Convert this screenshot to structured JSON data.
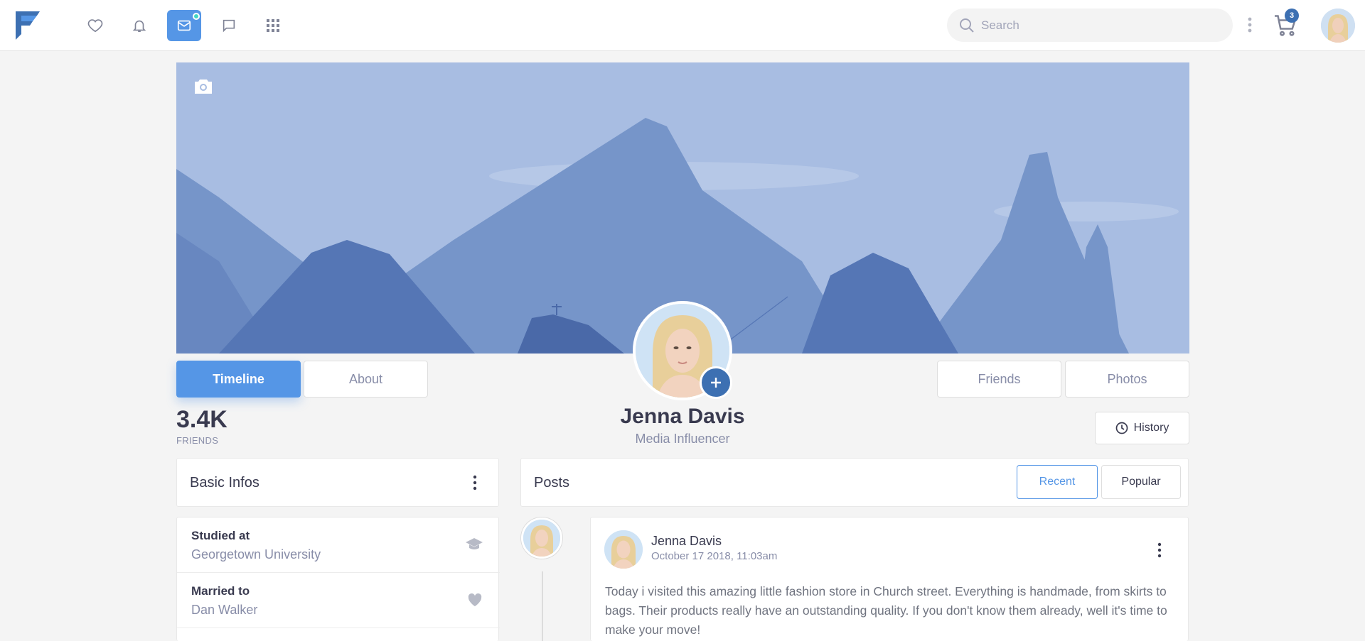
{
  "nav": {
    "search_placeholder": "Search",
    "cart_count": "3",
    "icons": [
      "heart-icon",
      "bell-icon",
      "mail-icon",
      "chat-icon",
      "apps-grid-icon"
    ]
  },
  "profile": {
    "name": "Jenna Davis",
    "title": "Media Influencer",
    "friends_count": "3.4K",
    "friends_label": "FRIENDS",
    "tabs_left": [
      "Timeline",
      "About"
    ],
    "tabs_right": [
      "Friends",
      "Photos"
    ],
    "history_label": "History"
  },
  "basic_infos": {
    "title": "Basic Infos",
    "rows": [
      {
        "label": "Studied at",
        "value": "Georgetown University",
        "icon": "graduation-cap-icon"
      },
      {
        "label": "Married to",
        "value": "Dan Walker",
        "icon": "heart-icon"
      }
    ]
  },
  "posts": {
    "title": "Posts",
    "filters": [
      "Recent",
      "Popular"
    ],
    "active_filter": "Recent",
    "items": [
      {
        "author": "Jenna Davis",
        "date": "October 17 2018, 11:03am",
        "text": "Today i visited this amazing little fashion store in Church street. Everything is handmade, from skirts to bags. Their products really have an outstanding quality. If you don't know them already, well it's time to make your move!"
      }
    ]
  },
  "colors": {
    "accent": "#5596e6",
    "dark_accent": "#3d70b2",
    "notification_dot": "#41d6c3",
    "cover_sky": "#a8bde2"
  }
}
